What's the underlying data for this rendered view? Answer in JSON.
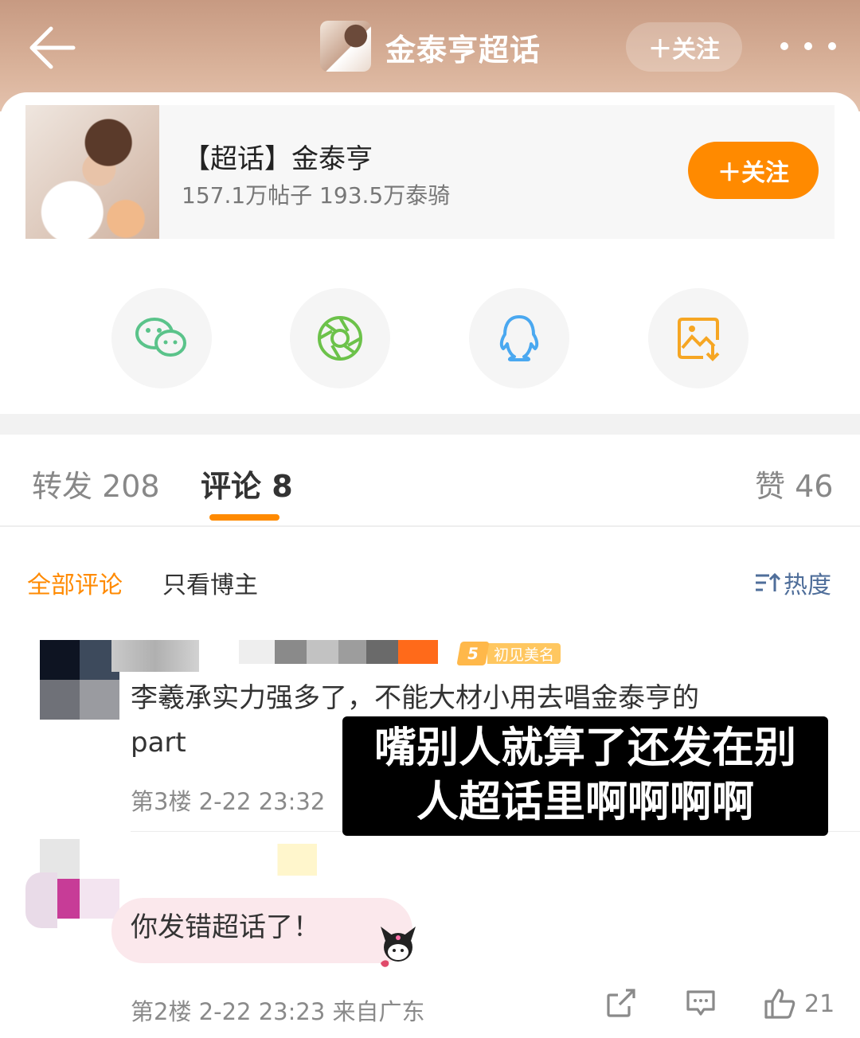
{
  "header": {
    "title": "金泰亨超话",
    "follow_label": "＋关注"
  },
  "topic_card": {
    "name": "【超话】金泰亨",
    "stats": "157.1万帖子 193.5万泰骑",
    "follow_label": "＋关注"
  },
  "share_targets": [
    {
      "icon": "wechat-icon",
      "color": "#5ac38a"
    },
    {
      "icon": "moments-icon",
      "color": "#6cc24a"
    },
    {
      "icon": "qq-icon",
      "color": "#4aa8f0"
    },
    {
      "icon": "save-image-icon",
      "color": "#f6a623"
    }
  ],
  "tabs": {
    "repost": "转发 208",
    "comments": "评论 8",
    "likes": "赞 46"
  },
  "filters": {
    "all": "全部评论",
    "author_only": "只看博主",
    "sort": "热度"
  },
  "comments": [
    {
      "badge_level": "5",
      "badge_text": "初见美名",
      "line1": "李羲承实力强多了，不能大材小用去唱金泰亨的",
      "line2": "part",
      "meta": "第3楼 2-22 23:32"
    },
    {
      "text": "你发错超话了！",
      "meta": "第2楼 2-22 23:23 来自广东",
      "like_count": "21"
    }
  ],
  "overlay_caption": {
    "line1": "嘴别人就算了还发在别",
    "line2": "人超话里啊啊啊啊"
  },
  "colors": {
    "accent": "#ff8a00",
    "sort_link": "#4f6e9a"
  }
}
